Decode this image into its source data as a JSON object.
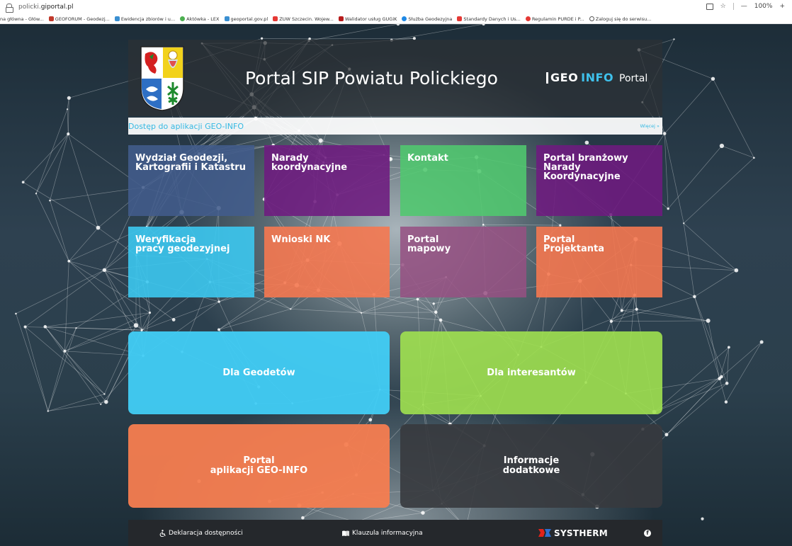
{
  "browser": {
    "url_prefix": "policki.",
    "url_domain": "giportal.pl",
    "zoom": "100%",
    "zoom_minus": "—",
    "zoom_plus": "+",
    "bookmarks": [
      {
        "label": "na główna - Głów...",
        "color": "#ffffff"
      },
      {
        "label": "GEOFORUM - Geodezj...",
        "color": "#c0392b"
      },
      {
        "label": "Ewidencja zbiorów i u...",
        "color": "#3a8fd1"
      },
      {
        "label": "Aktówka - LEX",
        "color": "#4caf50"
      },
      {
        "label": "geoportal.gov.pl",
        "color": "#3a8fd1"
      },
      {
        "label": "ZUW Szczecin. Wojew...",
        "color": "#e53935"
      },
      {
        "label": "Walidator usług GUGiK",
        "color": "#b71c1c"
      },
      {
        "label": "Służba Geodezyjna",
        "color": "#1e88e5"
      },
      {
        "label": "Standardy Danych i Us...",
        "color": "#e53935"
      },
      {
        "label": "Regulamin PURDE i P...",
        "color": "#e53935"
      },
      {
        "label": "Zaloguj się do serwisu...",
        "color": "#555555"
      }
    ]
  },
  "header": {
    "title": "Portal SIP Powiatu Polickiego",
    "logo_geo": "GEO",
    "logo_info": "INFO",
    "logo_portal": "Portal"
  },
  "access_bar": {
    "label": "Dostęp do aplikacji GEO-INFO",
    "more": "Więcej »"
  },
  "tiles": [
    {
      "label": "Wydział Geodezji,\nKartografii i Katastru"
    },
    {
      "label": "Narady\nkoordynacyjne"
    },
    {
      "label": "Kontakt"
    },
    {
      "label": "Portal branżowy\nNarady Koordynacyjne"
    },
    {
      "label": "Weryfikacja\npracy geodezyjnej"
    },
    {
      "label": "Wnioski NK"
    },
    {
      "label": "Portal\nmapowy"
    },
    {
      "label": "Portal\nProjektanta"
    }
  ],
  "big_tiles": [
    {
      "label": "Dla Geodetów"
    },
    {
      "label": "Dla interesantów"
    },
    {
      "label": "Portal\naplikacji GEO-INFO"
    },
    {
      "label": "Informacje\ndodatkowe"
    }
  ],
  "footer": {
    "accessibility": "Deklaracja dostępności",
    "info_clause": "Klauzula informacyjna",
    "brand": "SYSTHERM",
    "facebook": "f"
  },
  "colors": {
    "accent_cyan": "#3fc1ec",
    "tile_navy": "#425c8c",
    "tile_purple": "#6e1a80",
    "tile_green": "#50c86e",
    "tile_orange": "#f57850",
    "tile_mauve": "#965082",
    "big_lime": "#a0e150"
  }
}
